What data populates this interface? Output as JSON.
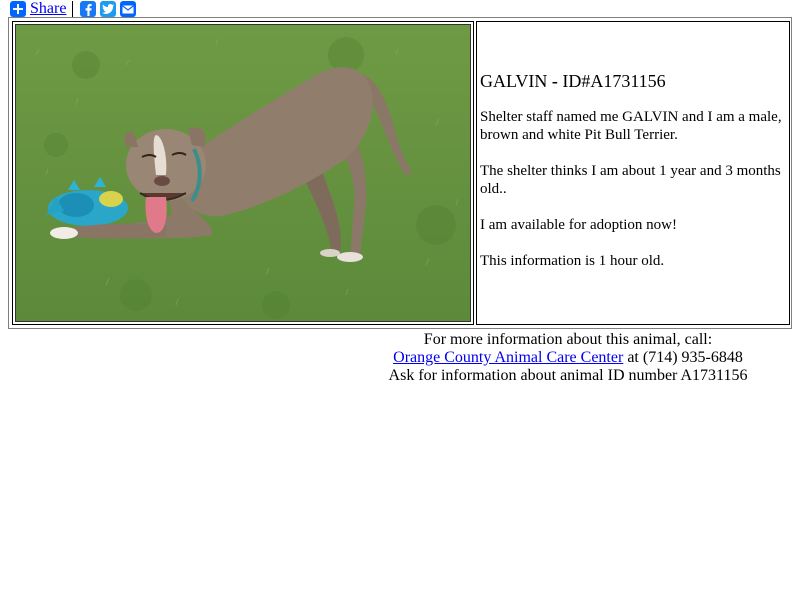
{
  "share": {
    "label": "Share",
    "icons": [
      "plus-icon",
      "facebook-icon",
      "twitter-icon",
      "email-icon"
    ],
    "colors": {
      "plus": "#0166ff",
      "facebook": "#1877f2",
      "twitter": "#1d9bf0",
      "email": "#0166ff"
    }
  },
  "pet": {
    "name": "GALVIN",
    "title_sep": " - ",
    "id_label": "ID#A1731156",
    "description": "Shelter staff named me GALVIN and I am a male, brown and white Pit Bull Terrier.",
    "age": "The shelter thinks I am about 1 year and 3 months old..",
    "availability": "I am available for adoption now!",
    "freshness": "This information is 1 hour old."
  },
  "contact": {
    "line1": "For more information about this animal, call:",
    "shelter_name": "Orange County Animal Care Center",
    "phone_text": " at (714) 935-6848",
    "line3": "Ask for information about animal ID number A1731156"
  }
}
